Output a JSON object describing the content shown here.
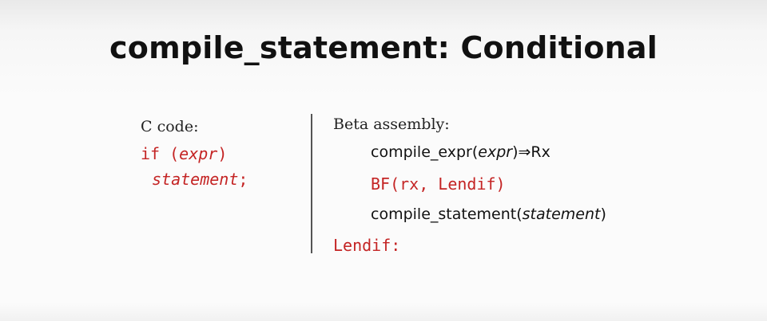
{
  "title": "compile_statement: Conditional",
  "left": {
    "label": "C code:",
    "line1": {
      "pre": "if (",
      "italic": "expr",
      "post": ")"
    },
    "line2": {
      "italic": "statement",
      "post": ";"
    }
  },
  "right": {
    "label": "Beta assembly:",
    "line1": {
      "pre": "compile_expr(",
      "italic": "expr",
      "post": ")⇒Rx"
    },
    "line2": "BF(rx, Lendif)",
    "line3": {
      "pre": "compile_statement(",
      "italic": "statement",
      "post": ")"
    },
    "line4": "Lendif:"
  },
  "colors": {
    "code_red": "#c42424",
    "text": "#111111"
  }
}
